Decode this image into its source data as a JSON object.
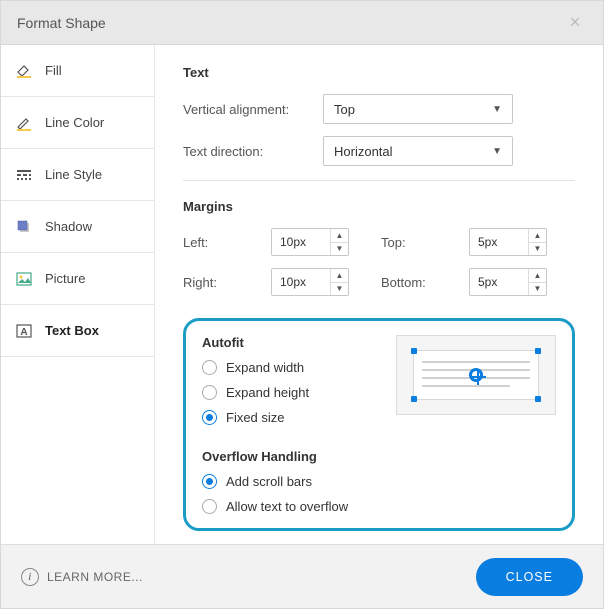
{
  "dialog": {
    "title": "Format Shape"
  },
  "sidebar": {
    "items": [
      {
        "label": "Fill"
      },
      {
        "label": "Line Color"
      },
      {
        "label": "Line Style"
      },
      {
        "label": "Shadow"
      },
      {
        "label": "Picture"
      },
      {
        "label": "Text Box"
      }
    ]
  },
  "text_section": {
    "title": "Text",
    "valign_label": "Vertical alignment:",
    "valign_value": "Top",
    "direction_label": "Text direction:",
    "direction_value": "Horizontal"
  },
  "margins": {
    "title": "Margins",
    "left_label": "Left:",
    "left_value": "10px",
    "right_label": "Right:",
    "right_value": "10px",
    "top_label": "Top:",
    "top_value": "5px",
    "bottom_label": "Bottom:",
    "bottom_value": "5px"
  },
  "autofit": {
    "title": "Autofit",
    "options": [
      {
        "label": "Expand width"
      },
      {
        "label": "Expand height"
      },
      {
        "label": "Fixed size"
      }
    ],
    "selected_index": 2
  },
  "overflow": {
    "title": "Overflow Handling",
    "options": [
      {
        "label": "Add scroll bars"
      },
      {
        "label": "Allow text to overflow"
      }
    ],
    "selected_index": 0
  },
  "footer": {
    "learn_more": "LEARN MORE...",
    "close": "CLOSE"
  }
}
